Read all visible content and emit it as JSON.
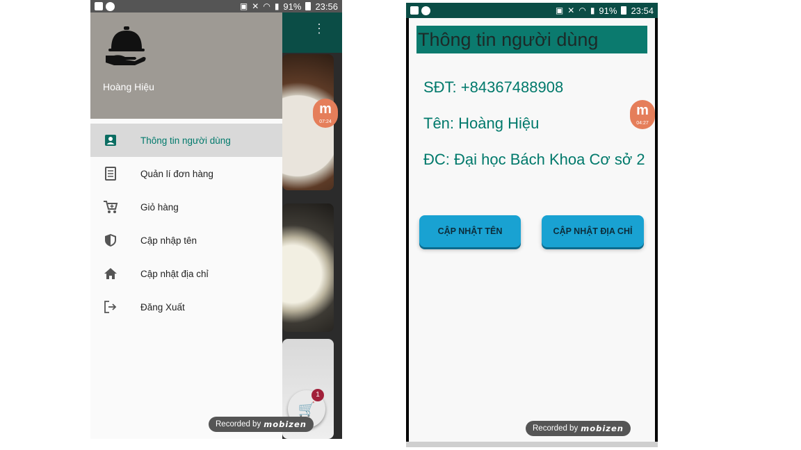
{
  "left_phone": {
    "status": {
      "battery": "91%",
      "time": "23:56"
    },
    "drawer": {
      "user_name": "Hoàng Hiệu",
      "items": [
        {
          "label": "Thông tin người dùng",
          "icon": "account-box-icon",
          "active": true
        },
        {
          "label": "Quản lí đơn hàng",
          "icon": "receipt-list-icon",
          "active": false
        },
        {
          "label": "Giỏ hàng",
          "icon": "cart-add-icon",
          "active": false
        },
        {
          "label": "Cập nhập tên",
          "icon": "shield-icon",
          "active": false
        },
        {
          "label": "Cập nhật địa chỉ",
          "icon": "home-icon",
          "active": false
        },
        {
          "label": "Đăng Xuất",
          "icon": "logout-icon",
          "active": false
        }
      ]
    },
    "cart_count": "1",
    "mobizen_time": "07:24",
    "recorded_by": "Recorded by",
    "recorder_brand": "mobizen"
  },
  "right_phone": {
    "status": {
      "battery": "91%",
      "time": "23:54"
    },
    "title": "Thông tin người dùng",
    "phone_line": "SĐT: +84367488908",
    "name_line": "Tên: Hoàng Hiệu",
    "address_line": "ĐC: Đại học Bách Khoa Cơ sở 2",
    "buttons": {
      "update_name": "CẬP NHẬT TÊN",
      "update_address": "CẬP NHẬT ĐỊA CHỈ"
    },
    "mobizen_time": "04:27",
    "recorded_by": "Recorded by",
    "recorder_brand": "mobizen"
  },
  "colors": {
    "primary_dark": "#0b4d46",
    "accent_teal": "#00796b",
    "button_blue": "#19a2d2"
  }
}
